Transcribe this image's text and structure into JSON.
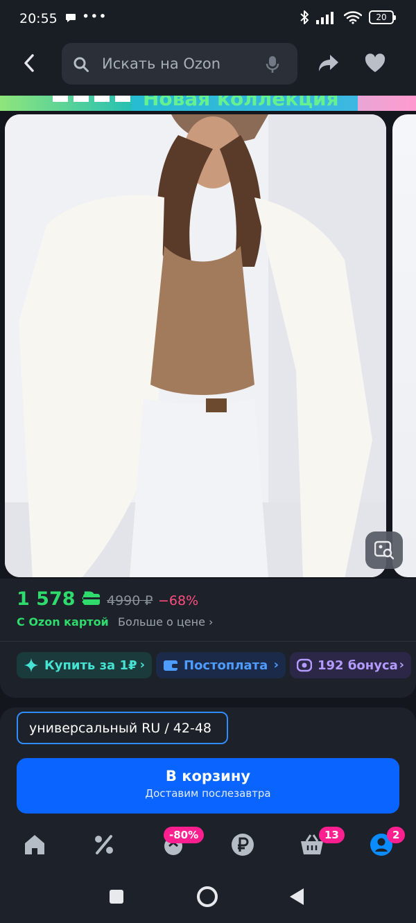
{
  "status": {
    "time": "20:55",
    "dots": "•••",
    "battery": "20"
  },
  "search": {
    "placeholder": "Искать на Ozon"
  },
  "icons": {
    "back": "chevron-left-icon",
    "search": "search-icon",
    "mic": "microphone-icon",
    "share": "share-icon",
    "favorite": "heart-icon",
    "visual_search": "image-search-icon"
  },
  "banner": {
    "text": "Новая коллекция"
  },
  "product": {
    "price_card": "1 578 ₽",
    "price_old": "4990 ₽",
    "discount": "−68%",
    "ozon_card_label": "С Ozon картой",
    "more_price": "Больше о цене ›"
  },
  "chips": {
    "buy_for_1": "Купить за 1₽",
    "postpay": "Постоплата",
    "bonus": "192 бонуса",
    "chevron": "›"
  },
  "size": {
    "selected": "универсальный RU / 42-48"
  },
  "cart": {
    "title": "В корзину",
    "subtitle": "Доставим послезавтра"
  },
  "tabs": {
    "sale_badge": "-80%",
    "cart_badge": "13",
    "profile_badge": "2"
  },
  "colors": {
    "accent_green": "#2fdb6c",
    "accent_blue": "#0a64ff",
    "badge_pink": "#ff1f8f",
    "discount_pink": "#ff4d7d"
  }
}
